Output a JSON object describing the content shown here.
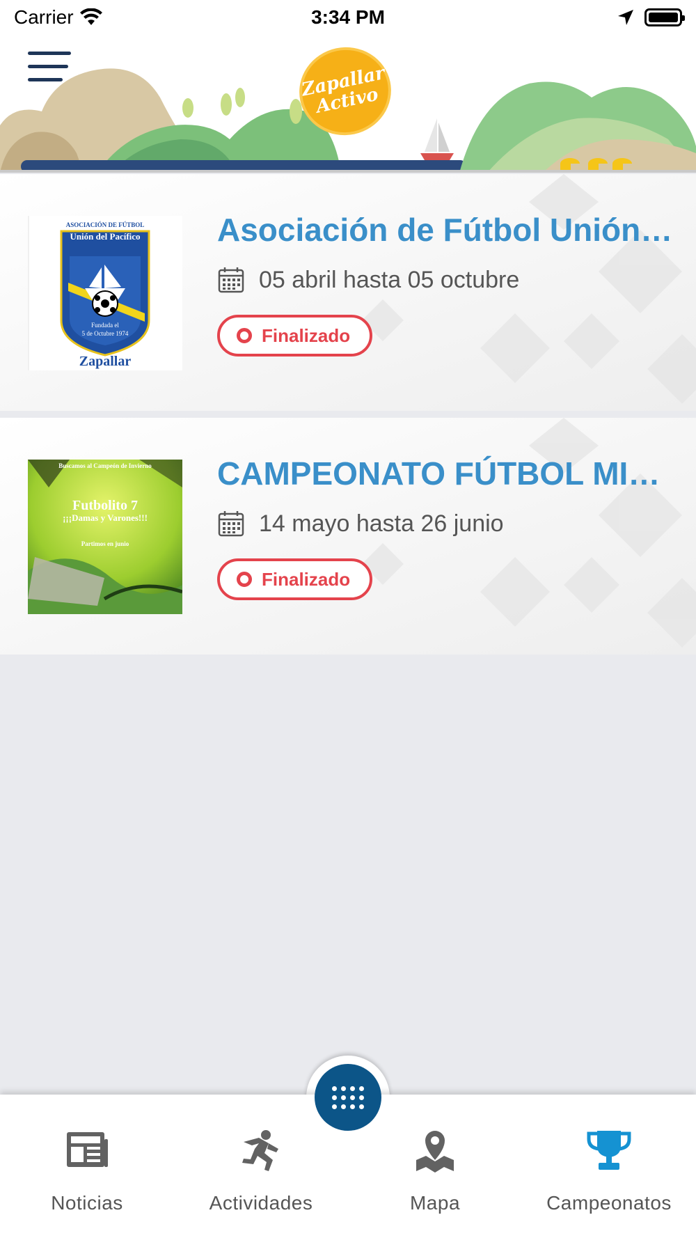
{
  "status_bar": {
    "carrier": "Carrier",
    "time": "3:34 PM"
  },
  "header": {
    "logo_line1": "Zapallar",
    "logo_line2": "Activo"
  },
  "championships": [
    {
      "title": "Asociación de Fútbol Unión del Pacífico",
      "dates": "05 abril hasta 05 octubre",
      "status": "Finalizado",
      "thumb": {
        "line1": "ASOCIACIÓN DE FÚTBOL",
        "line2": "Unión del Pacífico",
        "line3": "Fundada el",
        "line4": "5 de Octubre 1974",
        "line5": "Zapallar"
      }
    },
    {
      "title": "CAMPEONATO FÚTBOL MIXTO",
      "dates": "14 mayo hasta 26 junio",
      "status": "Finalizado",
      "thumb": {
        "line1": "Buscamos al Campeón de Invierno",
        "line2": "Futbolito 7",
        "line3": "¡¡¡Damas y Varones!!!",
        "line4": "Partimos en junio"
      }
    }
  ],
  "bottom_nav": {
    "items": [
      {
        "label": "Noticias",
        "icon": "newspaper-icon"
      },
      {
        "label": "Actividades",
        "icon": "runner-icon"
      },
      {
        "label": "Mapa",
        "icon": "map-pin-icon"
      },
      {
        "label": "Campeonatos",
        "icon": "trophy-icon"
      }
    ],
    "active_index": 3,
    "center_button_icon": "grid-icon"
  },
  "colors": {
    "title_blue": "#3a8fc9",
    "status_red": "#e4434c",
    "nav_dark_blue": "#0c5588",
    "active_icon": "#1592d2",
    "logo_yellow": "#f6b017"
  }
}
